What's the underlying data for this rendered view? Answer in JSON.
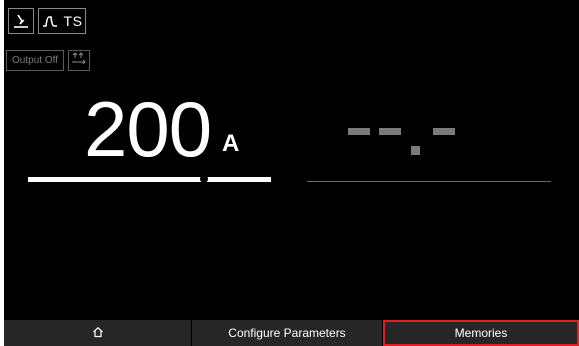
{
  "mode_bar": {
    "torch_icon": "welding-torch-icon",
    "waveform_icon": "pulse-waveform-icon",
    "mode_label": "TS"
  },
  "controls": {
    "output_label": "Output Off",
    "arrows_icon": "flow-arrows-icon"
  },
  "current": {
    "value": "200",
    "unit": "A",
    "slider_level_fraction": 0.72
  },
  "secondary_display": {
    "state": "no-value"
  },
  "bottom_nav": {
    "home_icon": "home-icon",
    "configure_label": "Configure Parameters",
    "memories_label": "Memories",
    "selected": "memories"
  },
  "colors": {
    "background": "#000000",
    "selection_outline": "#e02020",
    "nav_background": "#262626"
  }
}
